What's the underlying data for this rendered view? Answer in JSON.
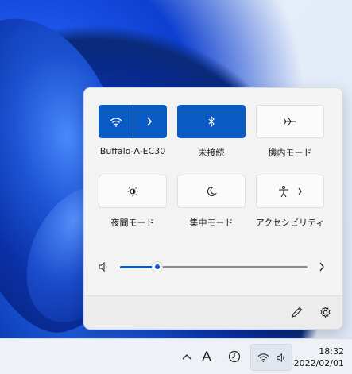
{
  "quick_settings": {
    "tiles": [
      {
        "id": "wifi",
        "label": "Buffalo-A-EC30",
        "state": "on",
        "icon": "wifi-icon",
        "has_chevron": true
      },
      {
        "id": "bluetooth",
        "label": "未接続",
        "state": "on",
        "icon": "bluetooth-icon"
      },
      {
        "id": "airplane",
        "label": "機内モード",
        "state": "off",
        "icon": "airplane-icon"
      },
      {
        "id": "night_light",
        "label": "夜間モード",
        "state": "off",
        "icon": "brightness-icon"
      },
      {
        "id": "focus",
        "label": "集中モード",
        "state": "off",
        "icon": "moon-icon"
      },
      {
        "id": "accessibility",
        "label": "アクセシビリティ",
        "state": "off",
        "icon": "accessibility-icon",
        "has_chevron": true
      }
    ],
    "volume": {
      "level_percent": 20,
      "icon": "speaker-icon"
    },
    "footer": {
      "edit_icon": "pencil-icon",
      "settings_icon": "gear-icon"
    },
    "accent_color": "#0a5bc4"
  },
  "taskbar": {
    "time": "18:32",
    "date": "2022/02/01",
    "ime_label": "A",
    "tray_icons": [
      "chevron-up-icon",
      "ime-icon",
      "clock-app-icon",
      "wifi-icon",
      "speaker-icon"
    ]
  }
}
